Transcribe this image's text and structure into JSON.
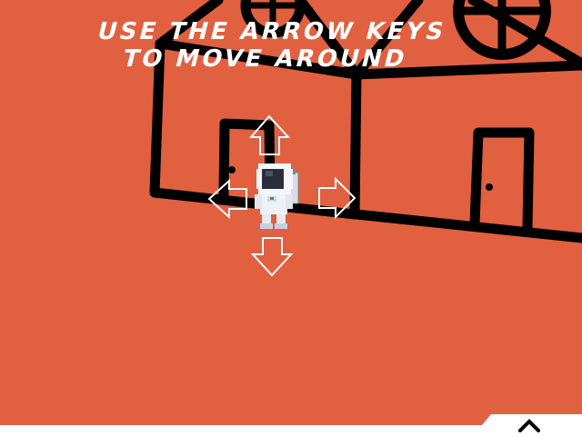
{
  "instruction": {
    "line1": "USE THE ARROW KEYS",
    "line2": "TO MOVE AROUND"
  },
  "controls": {
    "up": "arrow-up-icon",
    "down": "arrow-down-icon",
    "left": "arrow-left-icon",
    "right": "arrow-right-icon"
  },
  "player": {
    "character": "astronaut"
  },
  "menu_toggle": {
    "icon": "chevron-up-icon"
  },
  "colors": {
    "background": "#e06040",
    "lines": "#000000",
    "text": "#ffffff",
    "bar": "#ffffff"
  }
}
